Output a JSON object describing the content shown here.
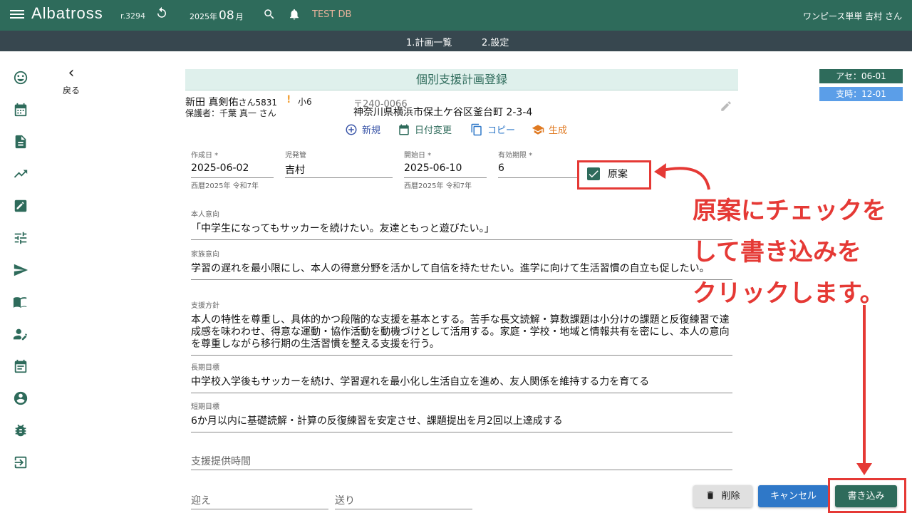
{
  "header": {
    "brand": "Albatross",
    "revision": "r.3294",
    "date_year": "2025年",
    "date_month": "08",
    "date_suffix": "月",
    "db_label": "TEST DB",
    "user": "ワンピース単単 吉村 さん"
  },
  "subnav": {
    "tabs": [
      "1.計画一覧",
      "2.設定"
    ]
  },
  "back_label": "戻る",
  "badges": {
    "ase": "アセ：06-01",
    "shiji": "支時：12-01"
  },
  "page_title": "個別支援計画登録",
  "person": {
    "name": "新田 真剣佑",
    "honorific": "さん",
    "id": "5831",
    "warn": "!",
    "grade": "小6",
    "guardian": "保護者：千葉 真一 さん",
    "zip": "〒240-0066",
    "address": "神奈川県横浜市保土ケ谷区釜台町 2-3-4"
  },
  "actions": {
    "new": "新規",
    "change_date": "日付変更",
    "copy": "コピー",
    "generate": "生成"
  },
  "fields": {
    "created_label": "作成日 *",
    "created_value": "2025-06-02",
    "created_hint": "西暦2025年 令和7年",
    "manager_label": "児発管",
    "manager_value": "吉村",
    "start_label": "開始日 *",
    "start_value": "2025-06-10",
    "start_hint": "西暦2025年 令和7年",
    "valid_label": "有効期限 *",
    "valid_value": "6",
    "draft_label": "原案"
  },
  "blocks": {
    "self_label": "本人意向",
    "self_text": "「中学生になってもサッカーを続けたい。友達ともっと遊びたい。」",
    "family_label": "家族意向",
    "family_text": "学習の遅れを最小限にし、本人の得意分野を活かして自信を持たせたい。進学に向けて生活習慣の自立も促したい。",
    "policy_label": "支援方針",
    "policy_text": "本人の特性を尊重し、具体的かつ段階的な支援を基本とする。苦手な長文読解・算数課題は小分けの課題と反復練習で達成感を味わわせ、得意な運動・協作活動を動機づけとして活用する。家庭・学校・地域と情報共有を密にし、本人の意向を尊重しながら移行期の生活習慣を整える支援を行う。",
    "long_label": "長期目標",
    "long_text": "中学校入学後もサッカーを続け、学習遅れを最小化し生活自立を進め、友人関係を維持する力を育てる",
    "short_label": "短期目標",
    "short_text": "6か月以内に基礎読解・計算の反復練習を安定させ、課題提出を月2回以上達成する"
  },
  "placeholders": {
    "support_time": "支援提供時間",
    "pickup": "迎え",
    "dropoff": "送り"
  },
  "buttons": {
    "delete": "削除",
    "cancel": "キャンセル",
    "write": "書き込み"
  },
  "annotation": {
    "line1": "原案にチェックを",
    "line2": "して書き込みを",
    "line3": "クリックします。"
  },
  "colors": {
    "header": "#2e6b5b",
    "subnav": "#37474f",
    "accent": "#2e6b5b",
    "annotation": "#e53935",
    "cancel": "#2f78c8"
  },
  "rail_icons": [
    "smiley-icon",
    "calendar-icon",
    "document-icon",
    "trending-icon",
    "edit-icon",
    "tune-icon",
    "send-icon",
    "book-icon",
    "person-edit-icon",
    "event-icon",
    "account-icon",
    "bug-icon",
    "login-icon"
  ]
}
